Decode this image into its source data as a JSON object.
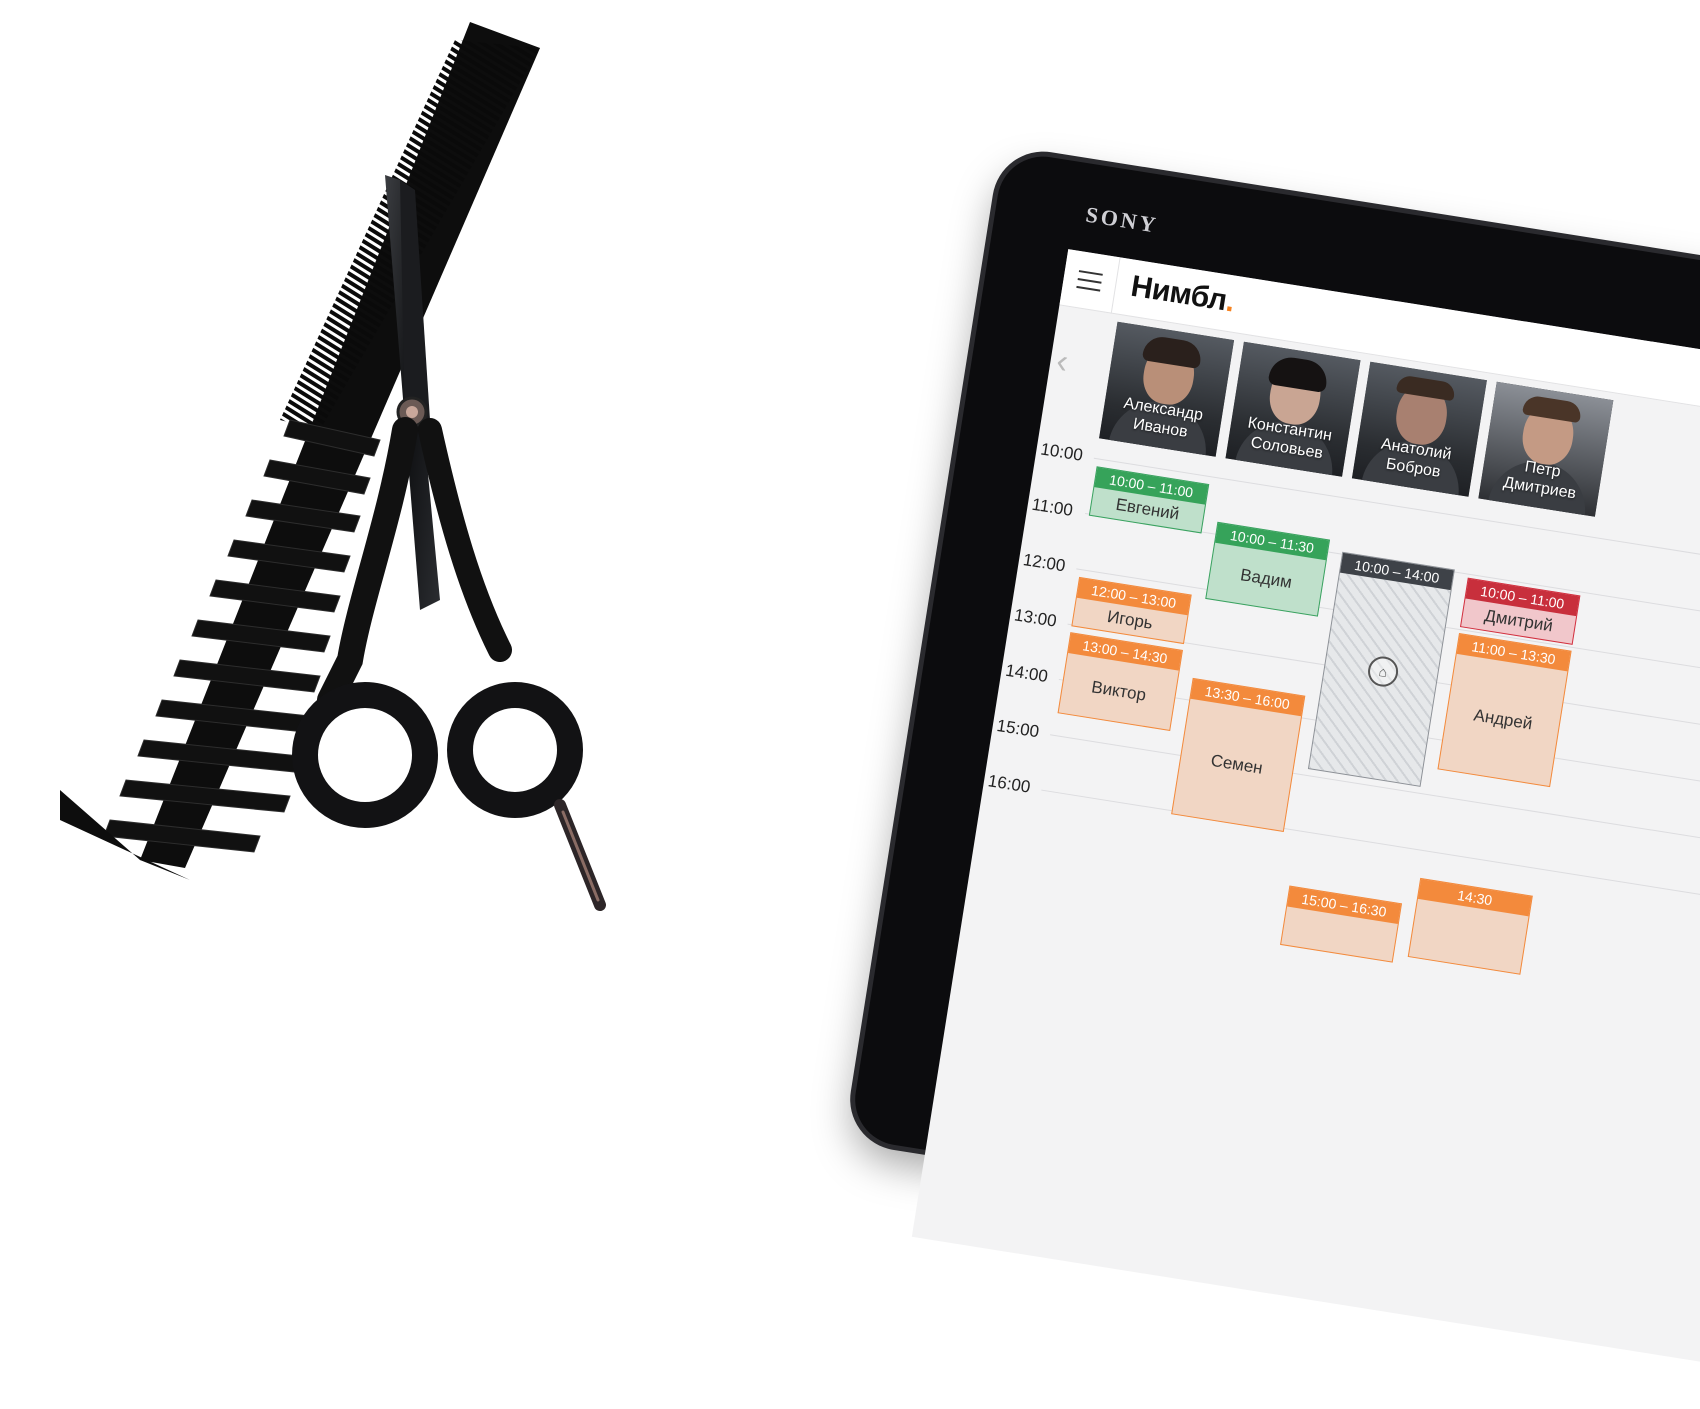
{
  "device": {
    "brand": "SONY"
  },
  "app": {
    "logo_text": "Нимбл",
    "logo_dot": "."
  },
  "staff": [
    {
      "name_first": "Александр",
      "name_last": "Иванов"
    },
    {
      "name_first": "Константин",
      "name_last": "Соловьев"
    },
    {
      "name_first": "Анатолий",
      "name_last": "Бобров"
    },
    {
      "name_first": "Петр",
      "name_last": "Дмитриев"
    }
  ],
  "times": [
    "10:00",
    "11:00",
    "12:00",
    "13:00",
    "14:00",
    "15:00",
    "16:00"
  ],
  "appointments": [
    {
      "time": "10:00 – 11:00",
      "client": "Евгений"
    },
    {
      "time": "10:00 – 11:30",
      "client": "Вадим"
    },
    {
      "time": "12:00 – 13:00",
      "client": "Игорь"
    },
    {
      "time": "13:00 – 14:30",
      "client": "Виктор"
    },
    {
      "time": "13:30 – 16:00",
      "client": "Семен"
    },
    {
      "time": "10:00 – 14:00",
      "client": ""
    },
    {
      "time": "10:00 – 11:00",
      "client": "Дмитрий"
    },
    {
      "time": "11:00 – 13:30",
      "client": "Андрей"
    },
    {
      "time": "15:00 – 16:30",
      "client": ""
    },
    {
      "time": "14:30",
      "client": ""
    }
  ],
  "colors": {
    "confirmed": "#36a35a",
    "pending": "#f38a3c",
    "cancelled": "#c82f3c",
    "blocked": "#3e4248",
    "accent": "#f58220"
  }
}
